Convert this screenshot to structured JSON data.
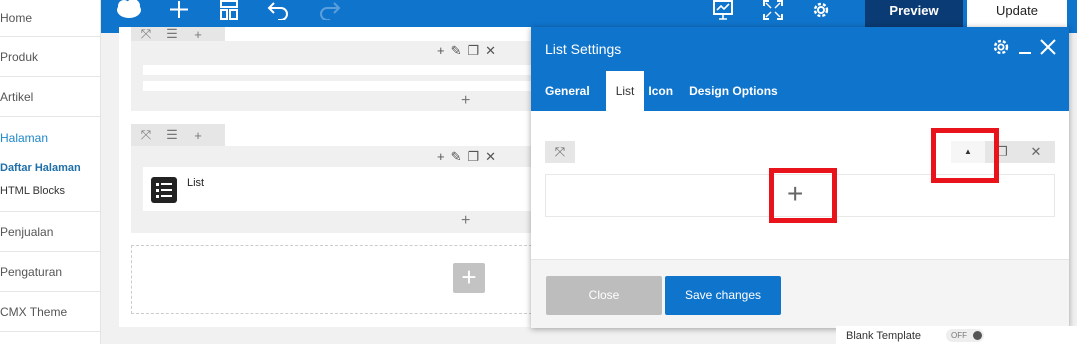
{
  "sidebar": {
    "items_top": [
      "Home",
      "Produk",
      "Artikel"
    ],
    "group": {
      "active": "Halaman",
      "sub_current": "Daftar Halaman",
      "sub_other": "HTML Blocks"
    },
    "items_bottom": [
      "Penjualan",
      "Pengaturan",
      "CMX Theme"
    ]
  },
  "toolbar": {
    "icons": [
      "cloud-icon",
      "plus-icon",
      "layout-icon",
      "undo-icon",
      "redo-icon",
      "presentation-icon",
      "fullscreen-icon",
      "gear-icon"
    ],
    "preview_label": "Preview",
    "update_label": "Update"
  },
  "canvas": {
    "element_label": "List"
  },
  "modal": {
    "title": "List Settings",
    "tabs": [
      "General",
      "List",
      "Icon",
      "Design Options"
    ],
    "active_tab": "List",
    "close_label": "Close",
    "save_label": "Save changes"
  },
  "right_panel": {
    "label": "Blank Template",
    "toggle_value": "OFF"
  },
  "colors": {
    "brand_blue": "#0f74cc",
    "preview_bg": "#0b3b74",
    "highlight_red": "#e8131b"
  }
}
